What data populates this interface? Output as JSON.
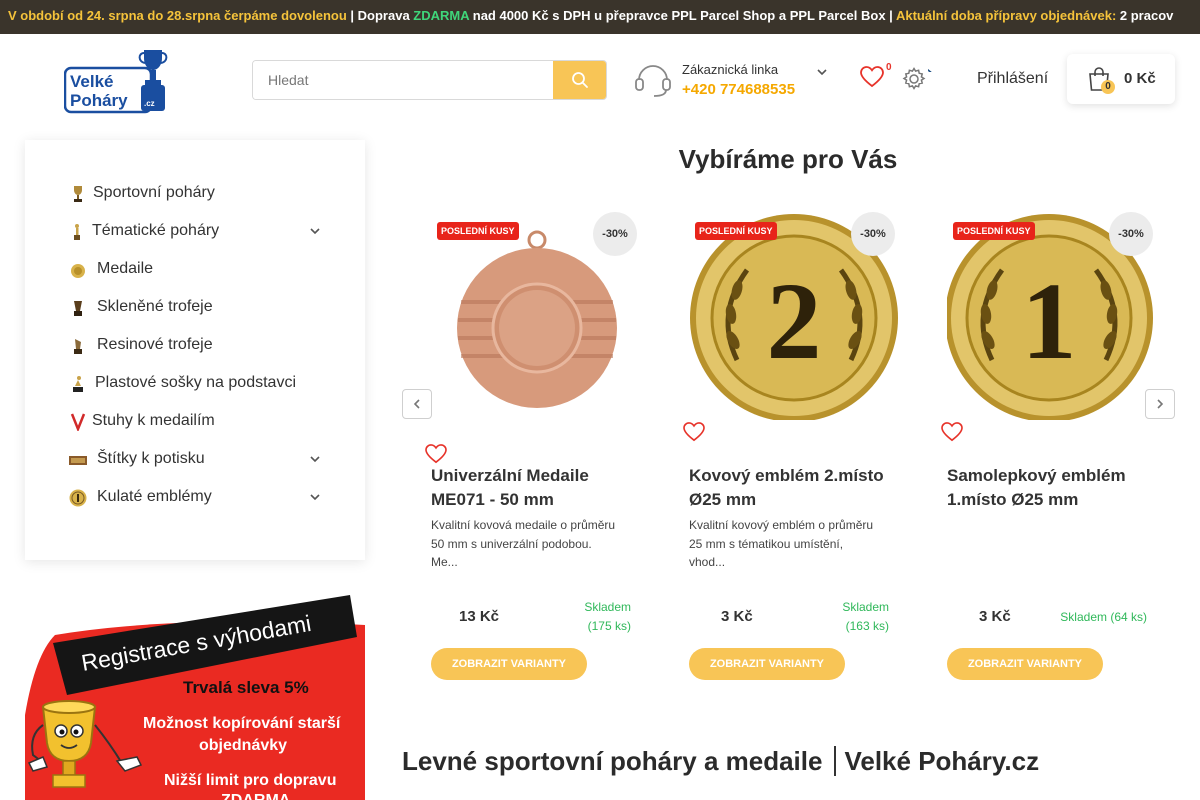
{
  "announcement": {
    "part1": "V období od 24. srpna do 28.srpna čerpáme dovolenou",
    "part2": " | Doprava ",
    "part3": "ZDARMA",
    "part4": " nad 4000 Kč s DPH u přepravce PPL Parcel Shop a PPL Parcel Box | ",
    "part5": "Aktuální doba přípravy objednávek:",
    "part6": " 2 pracov"
  },
  "header": {
    "logo_line1": "Velké",
    "logo_line2": "Poháry",
    "logo_suffix": ".cz",
    "search_placeholder": "Hledat",
    "support_label": "Zákaznická linka",
    "support_phone": "+420 774688535",
    "wishlist_count": "0",
    "login": "Přihlášení",
    "cart_count": "0",
    "cart_total": "0 Kč"
  },
  "sidebar": {
    "items": [
      {
        "label": "Sportovní poháry",
        "icon": "trophy-icon",
        "has_children": false
      },
      {
        "label": "Tématické poháry",
        "icon": "figure-trophy-icon",
        "has_children": true
      },
      {
        "label": "Medaile",
        "icon": "medal-icon",
        "has_children": false
      },
      {
        "label": "Skleněné trofeje",
        "icon": "glass-trophy-icon",
        "has_children": false
      },
      {
        "label": "Resinové trofeje",
        "icon": "resin-trophy-icon",
        "has_children": false
      },
      {
        "label": "Plastové sošky na podstavci",
        "icon": "statue-icon",
        "has_children": false
      },
      {
        "label": "Stuhy k medailím",
        "icon": "ribbon-icon",
        "has_children": false
      },
      {
        "label": "Štítky k potisku",
        "icon": "label-plate-icon",
        "has_children": true
      },
      {
        "label": "Kulaté emblémy",
        "icon": "emblem-icon",
        "has_children": true
      }
    ]
  },
  "promo": {
    "headline": "Registrace s výhodami",
    "benefit1": "Trvalá sleva 5%",
    "benefit2a": "Možnost kopírování starší",
    "benefit2b": "objednávky",
    "benefit3a": "Nižší limit pro dopravu",
    "benefit3b": "ZDARMA"
  },
  "main": {
    "section_title": "Vybíráme pro Vás",
    "bottom_title_a": "Levné sportovní poháry a medaile",
    "bottom_title_b": "Velké Poháry.cz",
    "products": [
      {
        "tag": "POSLEDNÍ KUSY",
        "discount": "-30%",
        "title": "Univerzální Medaile ME071 - 50 mm",
        "desc": "Kvalitní kovová medaile o průměru 50 mm s univerzální podobou. Me...",
        "price": "13 Kč",
        "stock_a": "Skladem",
        "stock_b": "(175 ks)",
        "cta": "ZOBRAZIT VARIANTY",
        "image": "bronze-medal"
      },
      {
        "tag": "POSLEDNÍ KUSY",
        "discount": "-30%",
        "title": "Kovový emblém 2.místo Ø25 mm",
        "desc": "Kvalitní kovový emblém o průměru 25 mm s tématikou umístění, vhod...",
        "price": "3 Kč",
        "stock_a": "Skladem",
        "stock_b": "(163 ks)",
        "cta": "ZOBRAZIT VARIANTY",
        "image": "gold-emblem-2"
      },
      {
        "tag": "POSLEDNÍ KUSY",
        "discount": "-30%",
        "title": "Samolepkový emblém 1.místo Ø25 mm",
        "desc": "",
        "price": "3 Kč",
        "stock_a": "Skladem (64 ks)",
        "stock_b": "",
        "cta": "ZOBRAZIT VARIANTY",
        "image": "gold-emblem-1"
      }
    ]
  },
  "colors": {
    "accent": "#f8c556",
    "phone": "#f5a800",
    "sale": "#e8241a",
    "stock": "#30b85a",
    "topbar": "#3a342b"
  }
}
